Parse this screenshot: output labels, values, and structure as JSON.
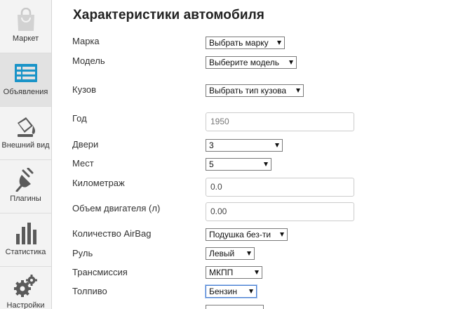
{
  "sidebar": {
    "items": [
      {
        "label": "Маркет",
        "icon": "shopping-bag-icon"
      },
      {
        "label": "Объявления",
        "icon": "list-icon",
        "active": true
      },
      {
        "label": "Внешний вид",
        "icon": "paint-bucket-icon"
      },
      {
        "label": "Плагины",
        "icon": "plug-icon"
      },
      {
        "label": "Статистика",
        "icon": "bar-chart-icon"
      },
      {
        "label": "Настройки",
        "icon": "gears-icon"
      }
    ]
  },
  "page": {
    "title": "Характеристики автомобиля"
  },
  "form": {
    "brand": {
      "label": "Марка",
      "value": "Выбрать марку"
    },
    "model": {
      "label": "Модель",
      "value": "Выберите модель"
    },
    "body": {
      "label": "Кузов",
      "value": "Выбрать тип кузова"
    },
    "year": {
      "label": "Год",
      "value": "1950"
    },
    "doors": {
      "label": "Двери",
      "value": "3"
    },
    "seats": {
      "label": "Мест",
      "value": "5"
    },
    "mileage": {
      "label": "Километраж",
      "value": "0.0"
    },
    "engine": {
      "label": "Объем двигателя (л)",
      "value": "0.00"
    },
    "airbags": {
      "label": "Количество AirBag",
      "value": "Подушка без-ти"
    },
    "steering": {
      "label": "Руль",
      "value": "Левый"
    },
    "transmission": {
      "label": "Трансмиссия",
      "value": "МКПП"
    },
    "fuel": {
      "label": "Толпиво",
      "value": "Бензин"
    }
  },
  "colors": {
    "sidebar_icon": "#5a5a5a",
    "active_icon": "#1a94c8",
    "focus_border": "#4a7fd1"
  }
}
